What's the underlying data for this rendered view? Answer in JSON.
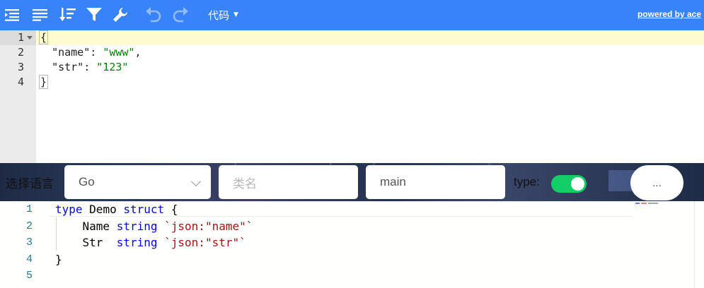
{
  "toolbar": {
    "icons": [
      "format-icon",
      "compact-icon",
      "sort-icon",
      "filter-icon",
      "repair-icon",
      "undo-icon",
      "redo-icon"
    ],
    "mode_label": "代码",
    "powered_by": "powered by ace",
    "background_color": "#3883fa"
  },
  "json_editor": {
    "line_numbers": [
      "1",
      "2",
      "3",
      "4"
    ],
    "lines": [
      {
        "open": "{"
      },
      {
        "key": "\"name\"",
        "value": "\"www\"",
        "trail": ","
      },
      {
        "key": "\"str\"",
        "value": "\"123\"",
        "trail": ""
      },
      {
        "close": "}"
      }
    ],
    "active_line_color": "#fffbd1"
  },
  "settings": {
    "language_label": "选择语言",
    "language_value": "Go",
    "class_name_placeholder": "类名",
    "package_value": "main",
    "type_label": "type:",
    "type_toggle_on": true,
    "more_label": "...",
    "toggle_color": "#13ce66"
  },
  "go_editor": {
    "line_numbers": [
      "1",
      "2",
      "3",
      "4",
      "5"
    ],
    "tokens": {
      "type": "type",
      "demo": "Demo",
      "struct": "struct",
      "open_brace": "{",
      "name_field": "Name",
      "string_kw": "string",
      "name_tag": "`json:\"name\"`",
      "str_field": "Str",
      "str_tag": "`json:\"str\"`",
      "close_brace": "}"
    }
  }
}
